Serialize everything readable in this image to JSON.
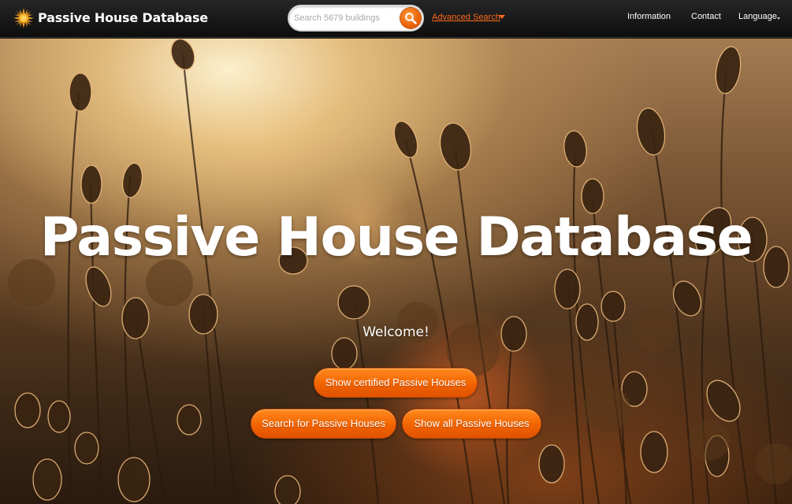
{
  "header": {
    "brand": "Passive House Database",
    "search": {
      "placeholder": "Search 5679 buildings"
    },
    "advanced_search": "Advanced Search",
    "nav": {
      "information": "Information",
      "contact": "Contact",
      "language": "Language"
    }
  },
  "hero": {
    "title": "Passive House Database",
    "welcome": "Welcome!",
    "buttons": {
      "certified": "Show certified Passive Houses",
      "search": "Search for Passive Houses",
      "all": "Show all Passive Houses"
    }
  },
  "colors": {
    "accent": "#f26300",
    "link": "#ff6a1a",
    "header_bg": "#111111"
  },
  "icons": {
    "logo": "sun-icon",
    "search": "magnifier-icon",
    "dropdown": "caret-down-icon"
  }
}
